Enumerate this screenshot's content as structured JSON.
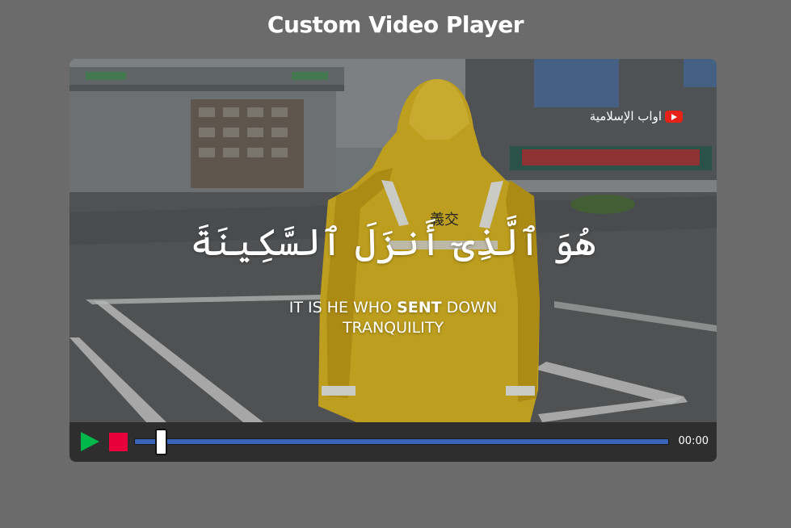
{
  "page": {
    "title": "Custom Video Player"
  },
  "video": {
    "channel_name": "اواب الإسلامية",
    "caption_arabic": "هُوَ ٱلَّذِىٓ أَنزَلَ ٱلسَّكِينَةَ",
    "caption_english_line1_pre": "IT IS HE WHO ",
    "caption_english_line1_bold": "SENT",
    "caption_english_line1_post": " DOWN",
    "caption_english_line2": "TRANQUILITY",
    "sign_text": "義交"
  },
  "controls": {
    "play_icon": "play-icon",
    "stop_icon": "stop-icon",
    "play_color": "#00b84a",
    "stop_color": "#e8003d",
    "progress_color": "#3a64b8",
    "progress_fraction": 0.04,
    "time": "00:00"
  }
}
